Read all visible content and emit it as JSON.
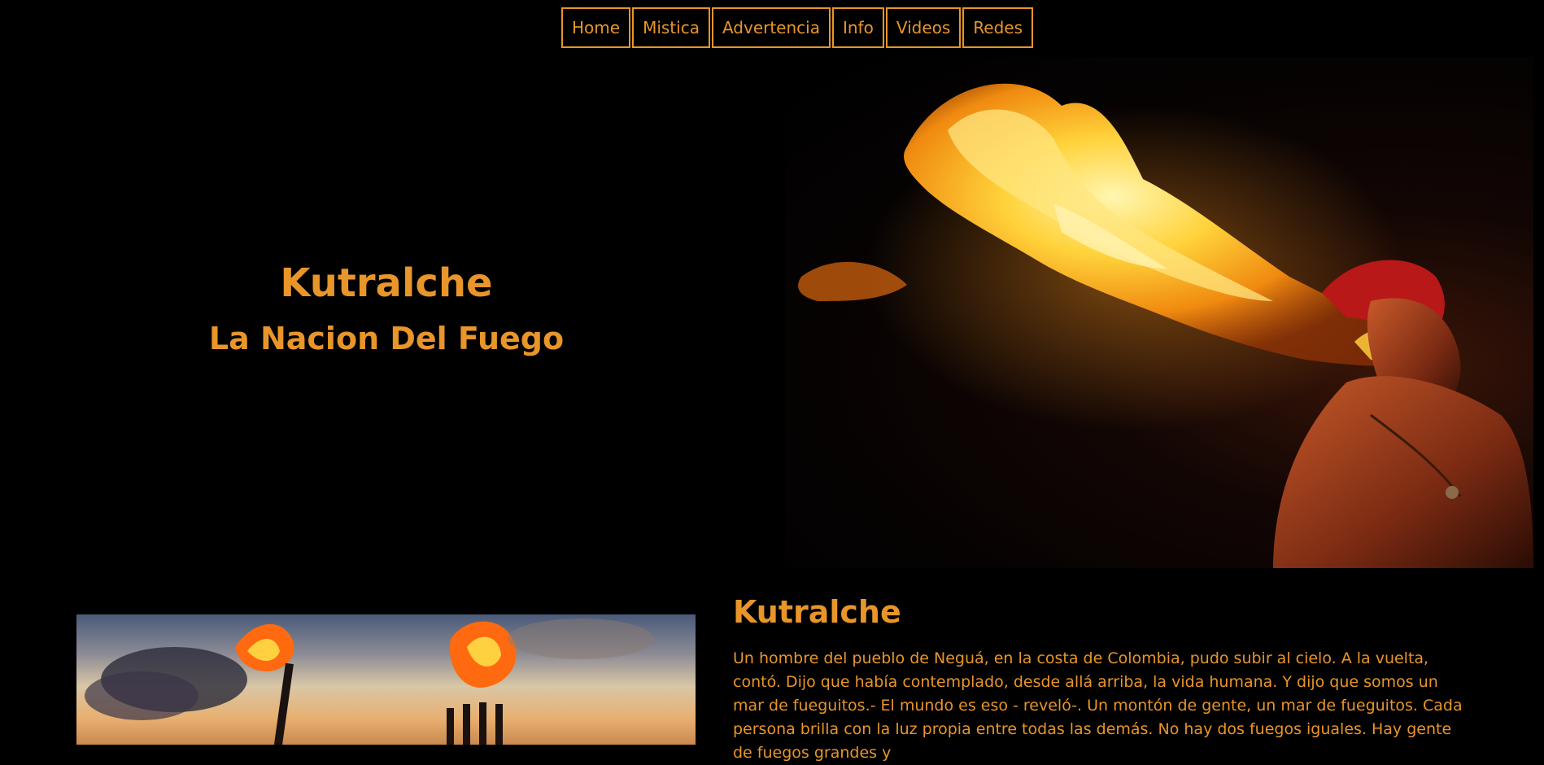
{
  "nav": {
    "items": [
      {
        "label": "Home"
      },
      {
        "label": "Mistica"
      },
      {
        "label": "Advertencia"
      },
      {
        "label": "Info"
      },
      {
        "label": "Videos"
      },
      {
        "label": "Redes"
      }
    ]
  },
  "hero": {
    "title": "Kutralche",
    "subtitle": "La Nacion Del Fuego",
    "image": "fire-breather-photo"
  },
  "section": {
    "title": "Kutralche",
    "image": "torches-sunset-photo",
    "text": "Un hombre del pueblo de Neguá, en la costa de Colombia, pudo subir al cielo. A la vuelta, contó. Dijo que había contemplado, desde allá arriba, la vida humana. Y dijo que somos un mar de fueguitos.- El mundo es eso - reveló-. Un montón de gente, un mar de fueguitos. Cada persona brilla con la luz propia entre todas las demás. No hay dos fuegos iguales. Hay gente de fuegos grandes y"
  },
  "colors": {
    "accent": "#e8952a",
    "background": "#000000"
  }
}
